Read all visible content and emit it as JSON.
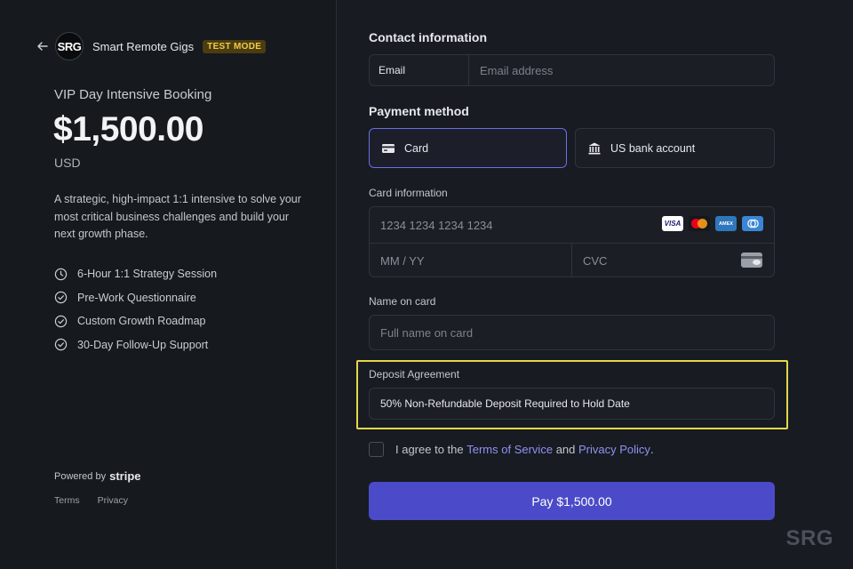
{
  "merchant": {
    "logo_text": "SRG",
    "name": "Smart Remote Gigs",
    "mode_badge": "TEST MODE"
  },
  "product": {
    "name": "VIP Day Intensive Booking",
    "price": "$1,500.00",
    "currency": "USD",
    "description": "A strategic, high-impact 1:1 intensive to solve your most critical business challenges and build your next growth phase.",
    "features": [
      {
        "label": "6-Hour 1:1 Strategy Session",
        "icon": "clock-icon"
      },
      {
        "label": "Pre-Work Questionnaire",
        "icon": "check-circle-icon"
      },
      {
        "label": "Custom Growth Roadmap",
        "icon": "check-circle-icon"
      },
      {
        "label": "30-Day Follow-Up Support",
        "icon": "check-circle-icon"
      }
    ]
  },
  "footer": {
    "powered_by": "Powered by",
    "stripe": "stripe",
    "links": [
      "Terms",
      "Privacy"
    ]
  },
  "form": {
    "contact_title": "Contact information",
    "email_label": "Email",
    "email_placeholder": "Email address",
    "payment_title": "Payment method",
    "methods": [
      {
        "label": "Card",
        "icon": "credit-card-icon",
        "selected": true
      },
      {
        "label": "US bank account",
        "icon": "bank-icon",
        "selected": false
      }
    ],
    "card_info_label": "Card information",
    "card_number_placeholder": "1234 1234 1234 1234",
    "card_brands": [
      "VISA",
      "Mastercard",
      "AMEX",
      "Diners Club"
    ],
    "expiry_placeholder": "MM / YY",
    "cvc_placeholder": "CVC",
    "name_label": "Name on card",
    "name_placeholder": "Full name on card",
    "deposit_label": "Deposit Agreement",
    "deposit_value": "50% Non-Refundable Deposit Required to Hold Date",
    "agree_prefix": "I agree to the",
    "terms_link": "Terms of Service",
    "agree_and": "and",
    "privacy_link": "Privacy Policy",
    "agree_suffix": ".",
    "pay_button": "Pay $1,500.00"
  },
  "watermark": "SRG",
  "colors": {
    "accent": "#4b4bc9",
    "link": "#8f93f2",
    "highlight": "#e4d84a",
    "badge": "#f2c94c"
  }
}
